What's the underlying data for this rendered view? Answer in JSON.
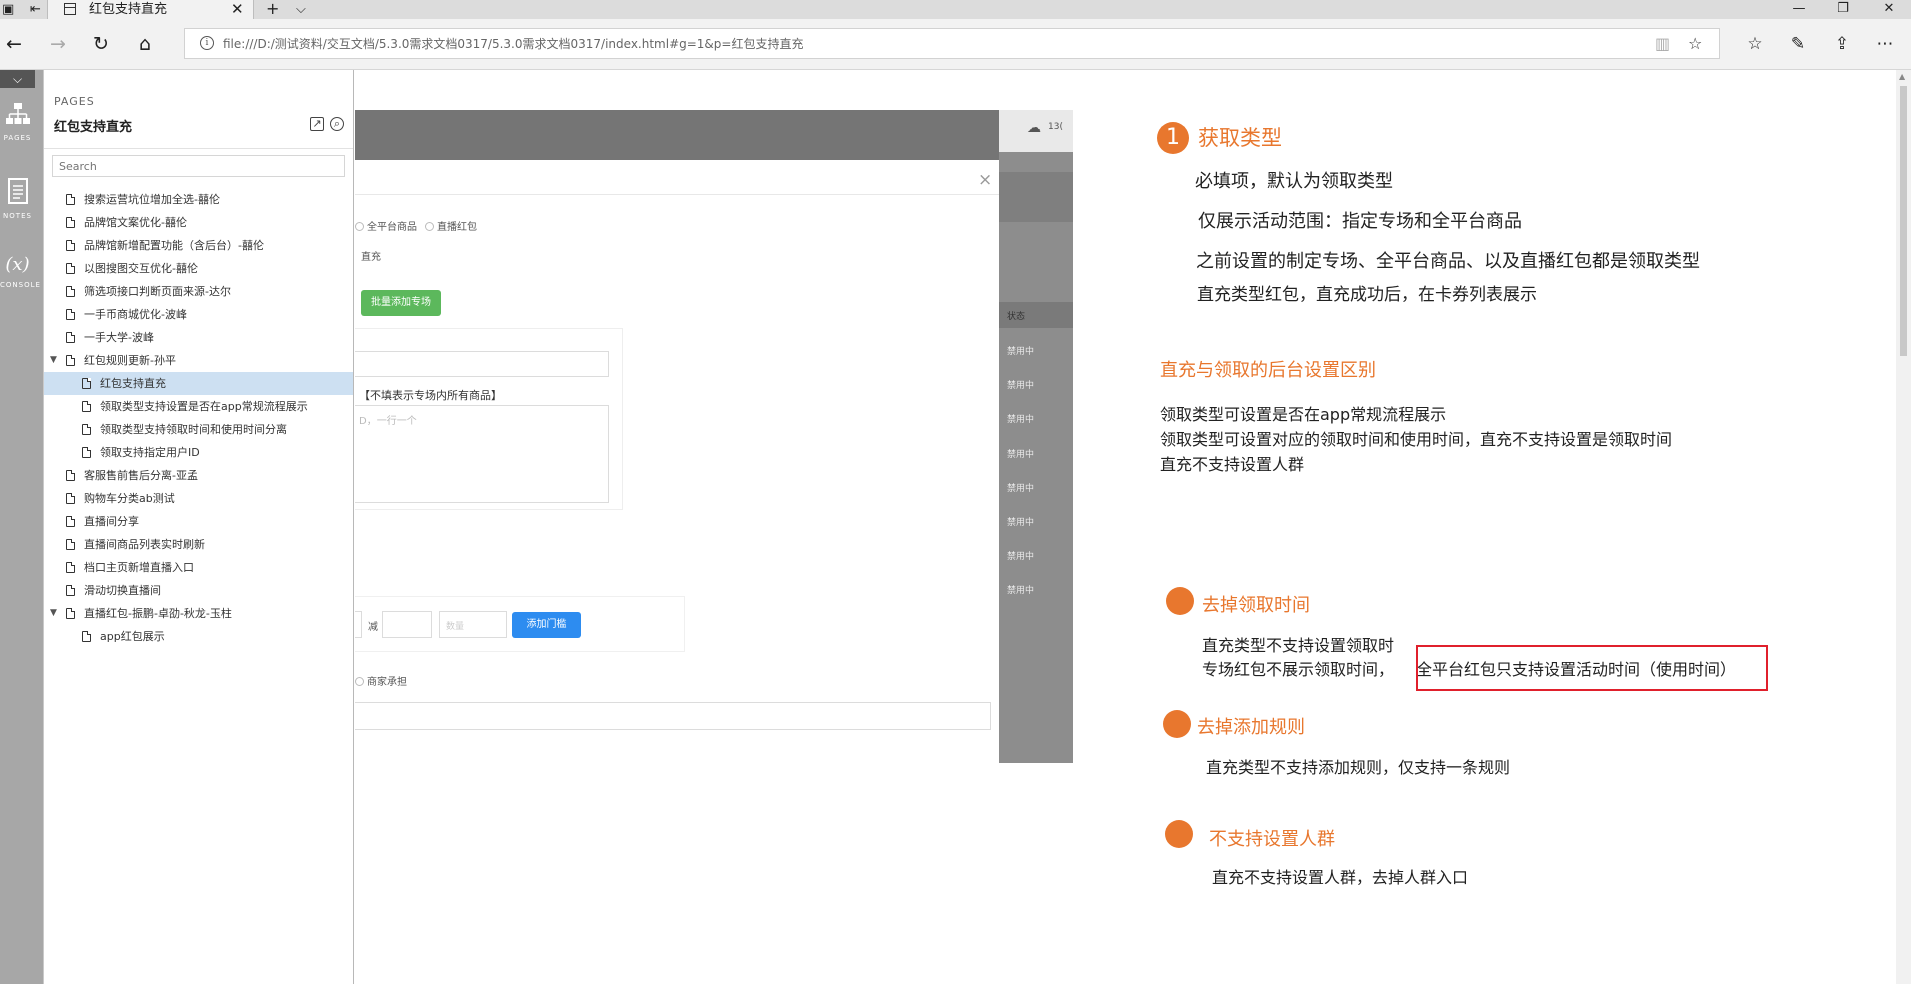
{
  "browser": {
    "tab_title": "红包支持直充",
    "tab_close": "✕",
    "new_tab": "+",
    "tab_menu": "⌵",
    "url": "file:///D:/测试资料/交互文档/5.3.0需求文档0317/5.3.0需求文档0317/index.html#g=1&p=红包支持直充",
    "win_min": "—",
    "win_max": "❐",
    "win_close": "✕"
  },
  "rail": {
    "toggle": "⌵",
    "items": [
      {
        "icon": "sitemap-icon",
        "label": "PAGES"
      },
      {
        "icon": "notes-icon",
        "label": "NOTES"
      },
      {
        "icon": "variable-icon",
        "glyph": "(x)",
        "label": "CONSOLE"
      }
    ]
  },
  "panel": {
    "label": "PAGES",
    "title": "红包支持直充",
    "search_placeholder": "Search",
    "tree": [
      {
        "label": "搜索运营坑位增加全选-囍伦",
        "level": 0,
        "expandable": false,
        "selected": false
      },
      {
        "label": "品牌馆文案优化-囍伦",
        "level": 0,
        "expandable": false,
        "selected": false
      },
      {
        "label": "品牌馆新增配置功能（含后台）-囍伦",
        "level": 0,
        "expandable": false,
        "selected": false
      },
      {
        "label": "以图搜图交互优化-囍伦",
        "level": 0,
        "expandable": false,
        "selected": false
      },
      {
        "label": "筛选项接口判断页面来源-达尔",
        "level": 0,
        "expandable": false,
        "selected": false
      },
      {
        "label": "一手币商城优化-波峰",
        "level": 0,
        "expandable": false,
        "selected": false
      },
      {
        "label": "一手大学-波峰",
        "level": 0,
        "expandable": false,
        "selected": false
      },
      {
        "label": "红包规则更新-孙平",
        "level": 0,
        "expandable": true,
        "selected": false
      },
      {
        "label": "红包支持直充",
        "level": 1,
        "expandable": false,
        "selected": true
      },
      {
        "label": "领取类型支持设置是否在app常规流程展示",
        "level": 1,
        "expandable": false,
        "selected": false
      },
      {
        "label": "领取类型支持领取时间和使用时间分离",
        "level": 1,
        "expandable": false,
        "selected": false
      },
      {
        "label": "领取支持指定用户ID",
        "level": 1,
        "expandable": false,
        "selected": false
      },
      {
        "label": "客服售前售后分离-亚孟",
        "level": 0,
        "expandable": false,
        "selected": false
      },
      {
        "label": "购物车分类ab测试",
        "level": 0,
        "expandable": false,
        "selected": false
      },
      {
        "label": "直播间分享",
        "level": 0,
        "expandable": false,
        "selected": false
      },
      {
        "label": "直播间商品列表实时刷新",
        "level": 0,
        "expandable": false,
        "selected": false
      },
      {
        "label": "档口主页新增直播入口",
        "level": 0,
        "expandable": false,
        "selected": false
      },
      {
        "label": "滑动切换直播间",
        "level": 0,
        "expandable": false,
        "selected": false
      },
      {
        "label": "直播红包-振鹏-卓劭-秋龙-玉柱",
        "level": 0,
        "expandable": true,
        "selected": false
      },
      {
        "label": "app红包展示",
        "level": 1,
        "expandable": false,
        "selected": false
      }
    ]
  },
  "mock": {
    "top_num": "13(",
    "dialog_close": "×",
    "radio_all": "全平台商品",
    "radio_live": "直播红包",
    "direct_label": "直充",
    "batch_btn": "批量添加专场",
    "hint": "【不填表示专场内所有商品】",
    "textarea_ph": "D，一行一个",
    "minus_label": "减",
    "qty_ph": "数量",
    "add_threshold": "添加门槛",
    "merchant": "商家承担",
    "status_header": "状态",
    "status_rows": [
      "禁用中",
      "禁用中",
      "禁用中",
      "禁用中",
      "禁用中",
      "禁用中",
      "禁用中",
      "禁用中"
    ]
  },
  "notes": {
    "s1_num": "1",
    "s1_title": "获取类型",
    "s1_lines": [
      "必填项，默认为领取类型",
      "仅展示活动范围：指定专场和全平台商品",
      "之前设置的制定专场、全平台商品、以及直播红包都是领取类型",
      "直充类型红包，直充成功后，在卡券列表展示"
    ],
    "s2_title": "直充与领取的后台设置区别",
    "s2_lines": [
      "领取类型可设置是否在app常规流程展示",
      "领取类型可设置对应的领取时间和使用时间，直充不支持设置是领取时间",
      "直充不支持设置人群"
    ],
    "s3_title": "去掉领取时间",
    "s3_line1": "直充类型不支持设置领取时",
    "s3_line2a": "专场红包不展示领取时间，",
    "s3_line2b": "全平台红包只支持设置活动时间（使用时间）",
    "s4_title": "去掉添加规则",
    "s4_line": "直充类型不支持添加规则，仅支持一条规则",
    "s5_title": "不支持设置人群",
    "s5_line": "直充不支持设置人群，去掉人群入口"
  },
  "colors": {
    "accent": "#e8772e",
    "highlight_box": "#e0202c",
    "selected_row": "#cde0f2",
    "green_btn": "#5cb85c",
    "blue_btn": "#2d8cf0"
  }
}
